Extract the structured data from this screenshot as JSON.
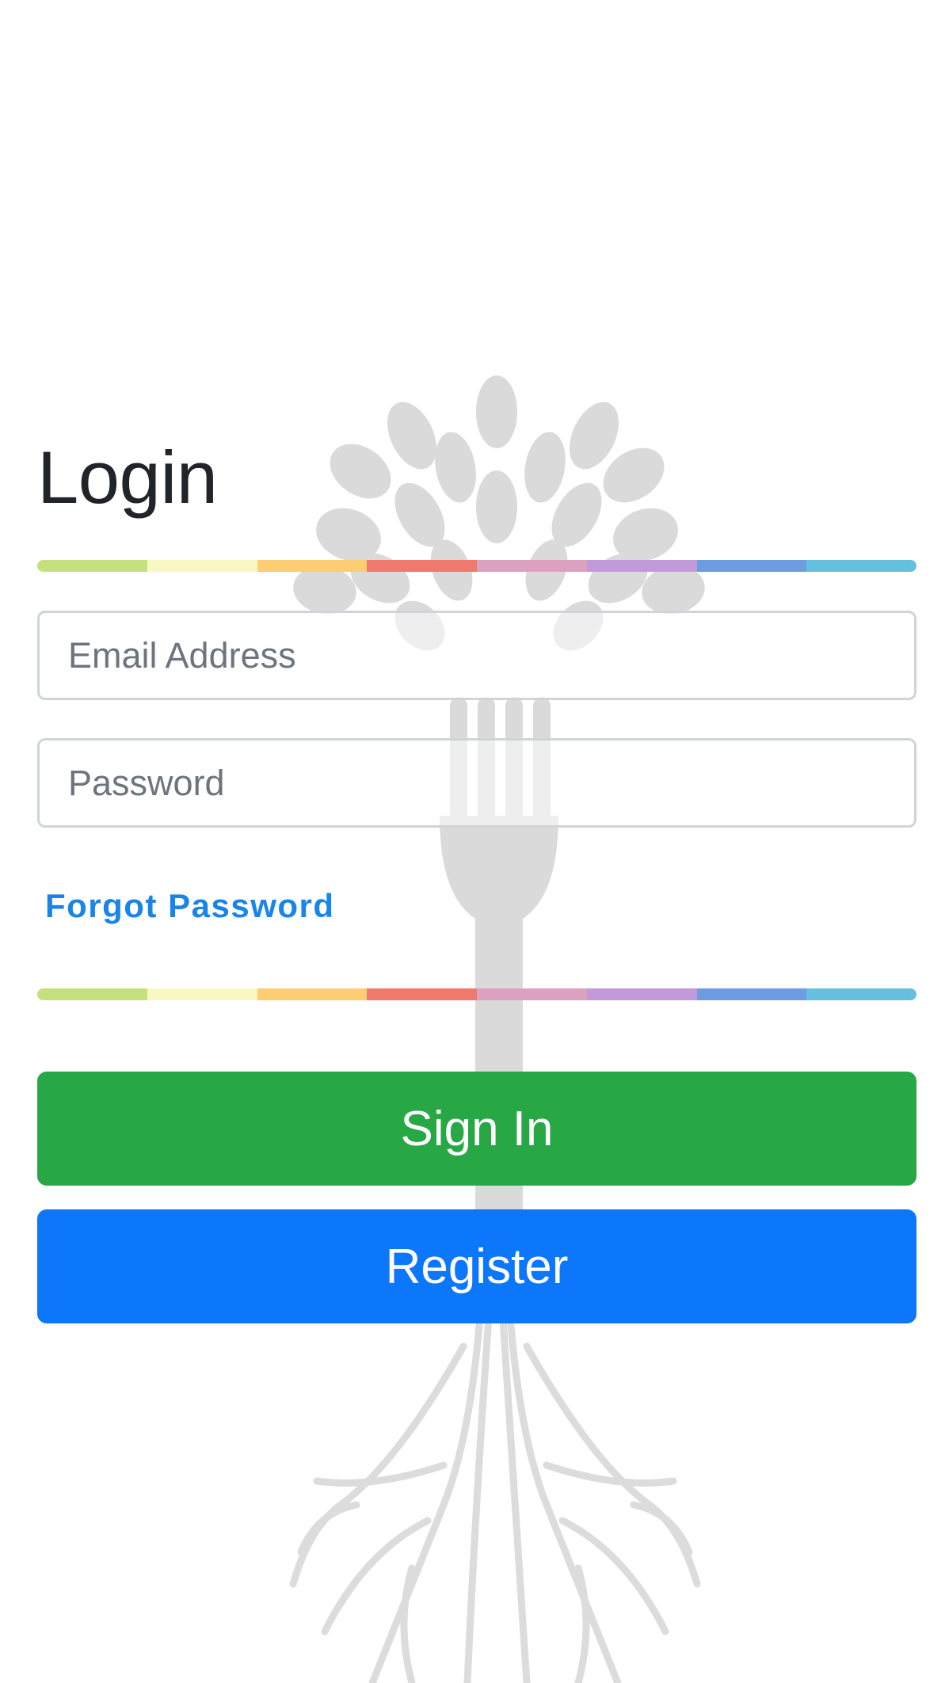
{
  "login": {
    "title": "Login",
    "email": {
      "placeholder": "Email Address",
      "value": ""
    },
    "password": {
      "placeholder": "Password",
      "value": ""
    },
    "forgot_password_label": "Forgot Password",
    "sign_in_label": "Sign In",
    "register_label": "Register"
  },
  "theme": {
    "rainbow_colors": [
      "#c5e17e",
      "#f9f8c2",
      "#fccd72",
      "#f0786c",
      "#dba1bf",
      "#c39ad9",
      "#6e9ce0",
      "#65c0e0"
    ],
    "sign_in_color": "#28a745",
    "register_color": "#0d77fc",
    "link_color": "#1a85e8",
    "watermark_color": "#d9d9d9"
  },
  "background": {
    "watermark_icon": "tree-fork-logo-icon"
  }
}
